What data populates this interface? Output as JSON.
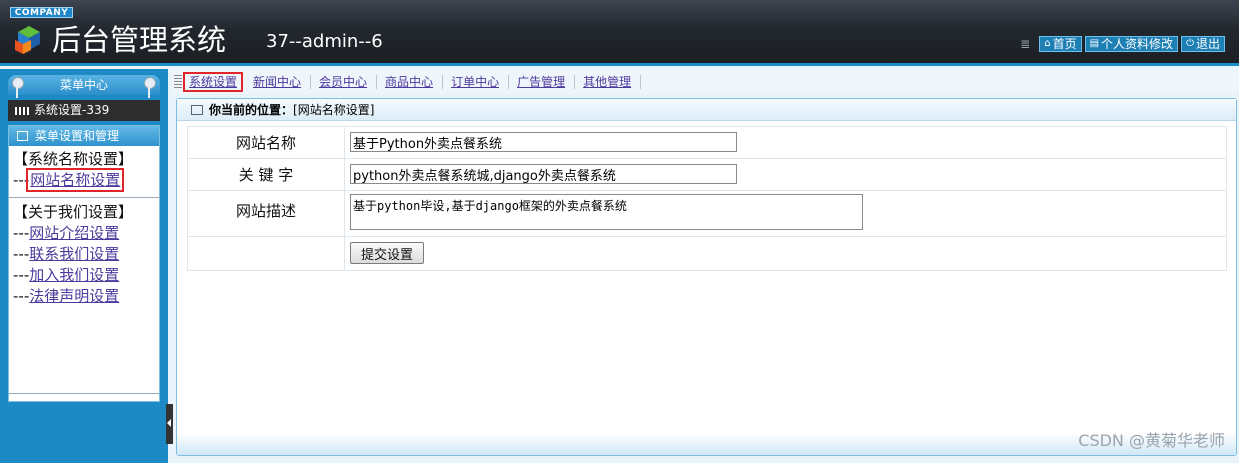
{
  "header": {
    "company": "COMPANY",
    "title": "后台管理系统",
    "user_info": "37--admin--6",
    "buttons": {
      "home": "首页",
      "profile": "个人资料修改",
      "logout": "退出"
    },
    "accent": "#1a8fc7"
  },
  "left": {
    "menu_center": "菜单中心",
    "system_bar": "系统设置-339",
    "box_title": "菜单设置和管理",
    "groups": [
      {
        "title": "【系统名称设置】",
        "items": [
          {
            "prefix": "---",
            "label": "网站名称设置"
          }
        ]
      },
      {
        "title": "【关于我们设置】",
        "items": [
          {
            "prefix": "---",
            "label": "网站介绍设置"
          },
          {
            "prefix": "---",
            "label": "联系我们设置"
          },
          {
            "prefix": "---",
            "label": "加入我们设置"
          },
          {
            "prefix": "---",
            "label": "法律声明设置"
          }
        ]
      }
    ]
  },
  "tabs": [
    "系统设置",
    "新闻中心",
    "会员中心",
    "商品中心",
    "订单中心",
    "广告管理",
    "其他管理"
  ],
  "location": {
    "label": "你当前的位置：",
    "value": "[网站名称设置]"
  },
  "form": {
    "site_name": {
      "label": "网站名称",
      "value": "基于Python外卖点餐系统"
    },
    "keywords": {
      "label": "关 键 字",
      "value": "python外卖点餐系统城,django外卖点餐系统"
    },
    "description": {
      "label": "网站描述",
      "value": "基于python毕设,基于django框架的外卖点餐系统"
    },
    "submit": "提交设置"
  },
  "watermark": "CSDN @黄菊华老师"
}
